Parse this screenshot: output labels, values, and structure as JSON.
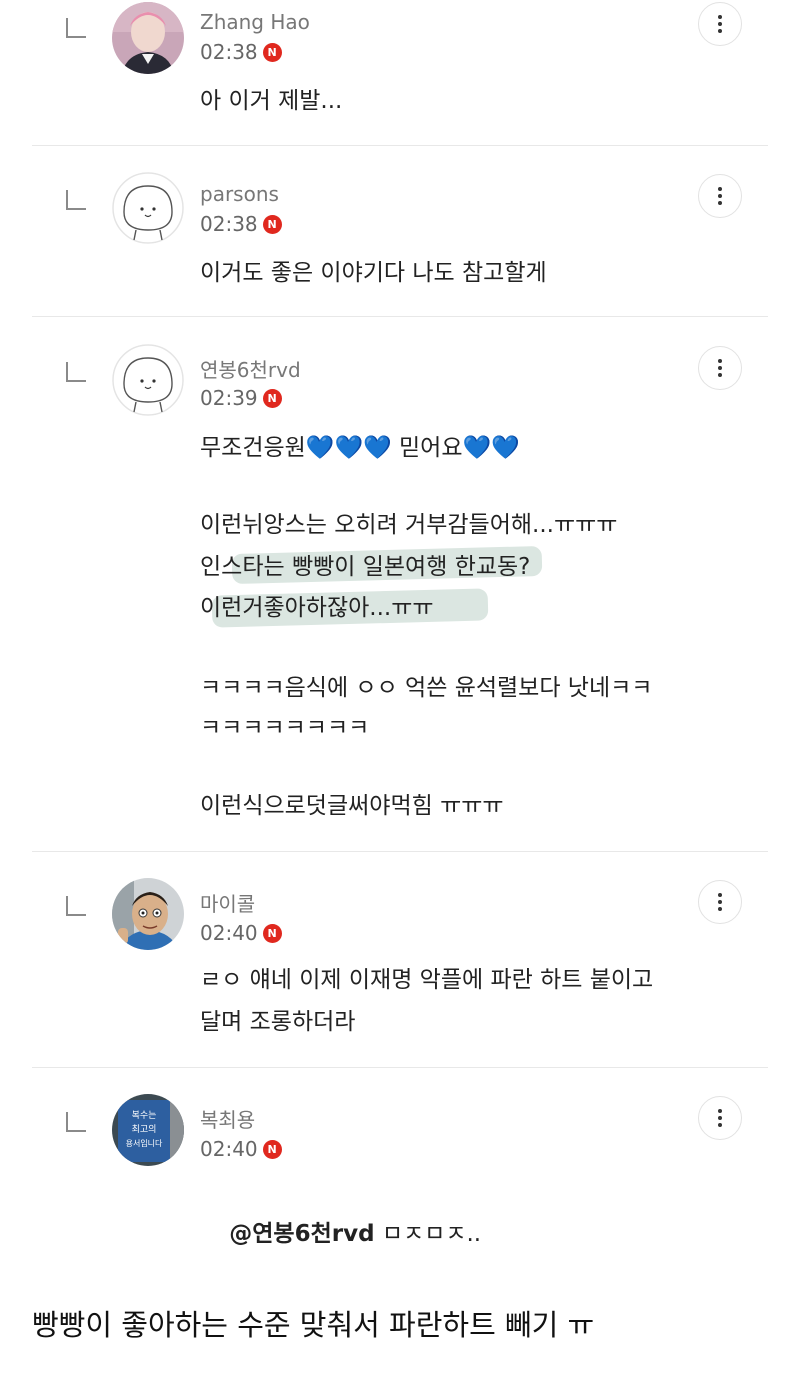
{
  "comments": [
    {
      "name": "Zhang Hao",
      "time": "02:38",
      "badge": "N",
      "lines": [
        "아 이거 제발..."
      ]
    },
    {
      "name": "parsons",
      "time": "02:38",
      "badge": "N",
      "lines": [
        "이거도 좋은 이야기다 나도 참고할게"
      ]
    },
    {
      "name": "연봉6천rvd",
      "time": "02:39",
      "badge": "N",
      "lines": [
        "무조건응원💙💙💙 믿어요💙💙",
        "",
        "이런뉘앙스는 오히려 거부감들어해...ㅠㅠㅠ",
        "인스타는 빵빵이 일본여행 한교동?",
        "이런거좋아하잖아...ㅠㅠ",
        "",
        "ㅋㅋㅋㅋ음식에 ㅇㅇ 억쓴 윤석렬보다 낫네ㅋㅋ",
        "ㅋㅋㅋㅋㅋㅋㅋㅋ",
        "",
        "이런식으로덧글써야먹힘 ㅠㅠㅠ"
      ]
    },
    {
      "name": "마이콜",
      "time": "02:40",
      "badge": "N",
      "lines": [
        "ㄹㅇ 얘네 이제 이재명 악플에 파란 하트 붙이고",
        "달며 조롱하더라"
      ]
    },
    {
      "name": "복최용",
      "time": "02:40",
      "badge": "N",
      "mention": "@연봉6천rvd",
      "text_after_mention": " ㅁㅈㅁㅈ..",
      "avatar_sign": [
        "복수는",
        "최고의",
        "용서입니다"
      ]
    }
  ],
  "caption": "빵빵이 좋아하는 수준 맞춰서 파란하트 빼기 ㅠ",
  "colors": {
    "badge": "#e0281e",
    "highlight": "#dbe6e1",
    "divider": "#e8e8e8"
  },
  "icons": [
    "reply-arrow-icon",
    "more-vertical-icon",
    "n-badge-icon"
  ]
}
